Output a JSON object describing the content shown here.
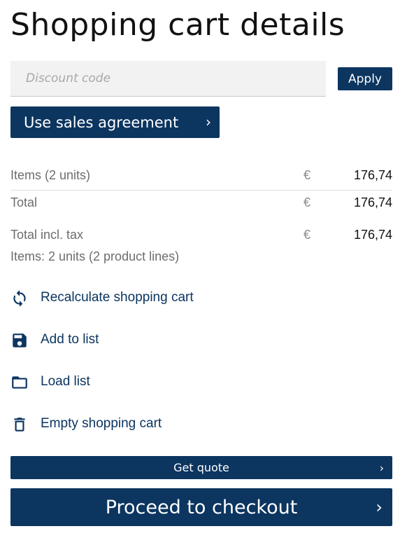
{
  "page": {
    "title": "Shopping cart details"
  },
  "discount": {
    "placeholder": "Discount code",
    "value": "",
    "apply_label": "Apply"
  },
  "agreement": {
    "label": "Use sales agreement",
    "chevron": "›"
  },
  "summary": {
    "rows": [
      {
        "label": "Items (2 units)",
        "currency": "€",
        "value": "176,74"
      },
      {
        "label": "Total",
        "currency": "€",
        "value": "176,74"
      },
      {
        "label": "Total incl. tax",
        "currency": "€",
        "value": "176,74"
      }
    ],
    "items_note": "Items: 2 units (2 product lines)"
  },
  "actions": [
    {
      "label": "Recalculate shopping cart",
      "icon": "refresh-icon"
    },
    {
      "label": "Add to list",
      "icon": "save-icon"
    },
    {
      "label": "Load list",
      "icon": "folder-icon"
    },
    {
      "label": "Empty shopping cart",
      "icon": "trash-icon"
    }
  ],
  "buttons": {
    "quote_label": "Get quote",
    "checkout_label": "Proceed to checkout",
    "chevron": "›"
  },
  "colors": {
    "primary": "#0c3560",
    "input_bg": "#f2f2f2",
    "muted_text": "#6d6d6d"
  }
}
